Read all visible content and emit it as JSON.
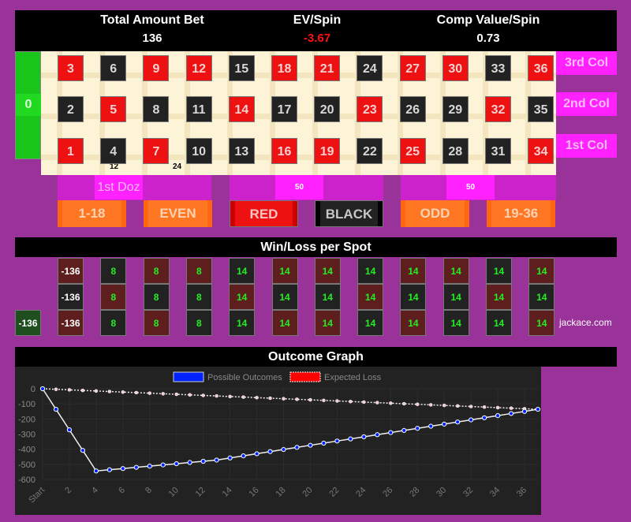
{
  "stats": {
    "total_bet_label": "Total Amount Bet",
    "total_bet_value": "136",
    "ev_label": "EV/Spin",
    "ev_value": "-3.67",
    "comp_label": "Comp Value/Spin",
    "comp_value": "0.73"
  },
  "table": {
    "zero": "0",
    "columns": [
      {
        "top": {
          "n": "3",
          "c": "red"
        },
        "mid": {
          "n": "2",
          "c": "black"
        },
        "bot": {
          "n": "1",
          "c": "red"
        }
      },
      {
        "top": {
          "n": "6",
          "c": "black"
        },
        "mid": {
          "n": "5",
          "c": "red"
        },
        "bot": {
          "n": "4",
          "c": "black"
        }
      },
      {
        "top": {
          "n": "9",
          "c": "red"
        },
        "mid": {
          "n": "8",
          "c": "black"
        },
        "bot": {
          "n": "7",
          "c": "red"
        }
      },
      {
        "top": {
          "n": "12",
          "c": "red"
        },
        "mid": {
          "n": "11",
          "c": "black"
        },
        "bot": {
          "n": "10",
          "c": "black"
        }
      },
      {
        "top": {
          "n": "15",
          "c": "black"
        },
        "mid": {
          "n": "14",
          "c": "red"
        },
        "bot": {
          "n": "13",
          "c": "black"
        }
      },
      {
        "top": {
          "n": "18",
          "c": "red"
        },
        "mid": {
          "n": "17",
          "c": "black"
        },
        "bot": {
          "n": "16",
          "c": "red"
        }
      },
      {
        "top": {
          "n": "21",
          "c": "red"
        },
        "mid": {
          "n": "20",
          "c": "black"
        },
        "bot": {
          "n": "19",
          "c": "red"
        }
      },
      {
        "top": {
          "n": "24",
          "c": "black"
        },
        "mid": {
          "n": "23",
          "c": "red"
        },
        "bot": {
          "n": "22",
          "c": "black"
        }
      },
      {
        "top": {
          "n": "27",
          "c": "red"
        },
        "mid": {
          "n": "26",
          "c": "black"
        },
        "bot": {
          "n": "25",
          "c": "red"
        }
      },
      {
        "top": {
          "n": "30",
          "c": "red"
        },
        "mid": {
          "n": "29",
          "c": "black"
        },
        "bot": {
          "n": "28",
          "c": "black"
        }
      },
      {
        "top": {
          "n": "33",
          "c": "black"
        },
        "mid": {
          "n": "32",
          "c": "red"
        },
        "bot": {
          "n": "31",
          "c": "black"
        }
      },
      {
        "top": {
          "n": "36",
          "c": "red"
        },
        "mid": {
          "n": "35",
          "c": "black"
        },
        "bot": {
          "n": "34",
          "c": "red"
        }
      }
    ],
    "column_bets": [
      "3rd Col",
      "2nd Col",
      "1st Col"
    ],
    "chip_labels": [
      "12",
      "24"
    ],
    "dozens": [
      "1st Doz",
      "50",
      "50"
    ],
    "outside_bets": [
      "1-18",
      "EVEN",
      "RED",
      "BLACK",
      "ODD",
      "19-36"
    ]
  },
  "winloss": {
    "title": "Win/Loss per Spot",
    "zero": "-136",
    "columns": [
      [
        "-136",
        "-136",
        "-136"
      ],
      [
        "8",
        "8",
        "8"
      ],
      [
        "8",
        "8",
        "8"
      ],
      [
        "8",
        "8",
        "8"
      ],
      [
        "14",
        "14",
        "14"
      ],
      [
        "14",
        "14",
        "14"
      ],
      [
        "14",
        "14",
        "14"
      ],
      [
        "14",
        "14",
        "14"
      ],
      [
        "14",
        "14",
        "14"
      ],
      [
        "14",
        "14",
        "14"
      ],
      [
        "14",
        "14",
        "14"
      ],
      [
        "14",
        "14",
        "14"
      ]
    ],
    "brand": "jackace.com"
  },
  "graph": {
    "title": "Outcome Graph"
  },
  "chart_data": {
    "type": "line",
    "title": "Outcome Graph",
    "x": [
      "Start",
      "1",
      "2",
      "3",
      "4",
      "5",
      "6",
      "7",
      "8",
      "9",
      "10",
      "11",
      "12",
      "13",
      "14",
      "15",
      "16",
      "17",
      "18",
      "19",
      "20",
      "21",
      "22",
      "23",
      "24",
      "25",
      "26",
      "27",
      "28",
      "29",
      "30",
      "31",
      "32",
      "33",
      "34",
      "35",
      "36",
      "37"
    ],
    "xtick_labels": [
      "Start",
      "2",
      "4",
      "6",
      "8",
      "10",
      "12",
      "14",
      "16",
      "18",
      "20",
      "22",
      "24",
      "26",
      "28",
      "30",
      "32",
      "34",
      "36"
    ],
    "series": [
      {
        "name": "Possible Outcomes",
        "color": "#0022ff",
        "values": [
          0,
          -136,
          -272,
          -408,
          -544,
          -536,
          -528,
          -520,
          -512,
          -504,
          -496,
          -488,
          -480,
          -472,
          -458,
          -444,
          -430,
          -416,
          -402,
          -388,
          -374,
          -360,
          -346,
          -332,
          -318,
          -304,
          -290,
          -276,
          -262,
          -248,
          -234,
          -220,
          -206,
          -192,
          -178,
          -164,
          -150,
          -136
        ]
      },
      {
        "name": "Expected Loss",
        "color": "#ff0000",
        "values": [
          0,
          -3.67,
          -7.35,
          -11.02,
          -14.7,
          -18.37,
          -22.05,
          -25.72,
          -29.41,
          -33.08,
          -36.76,
          -40.43,
          -44.11,
          -47.78,
          -51.46,
          -55.14,
          -58.81,
          -62.49,
          -66.16,
          -69.84,
          -73.51,
          -77.19,
          -80.86,
          -84.54,
          -88.22,
          -91.89,
          -95.57,
          -99.24,
          -102.92,
          -106.59,
          -110.27,
          -113.95,
          -117.62,
          -121.3,
          -124.97,
          -128.65,
          -132.32,
          -136
        ]
      }
    ],
    "ytick_labels": [
      "0",
      "-100",
      "-200",
      "-300",
      "-400",
      "-500",
      "-600"
    ],
    "ylim": [
      -600,
      0
    ],
    "legend": "top-center",
    "grid": true
  }
}
